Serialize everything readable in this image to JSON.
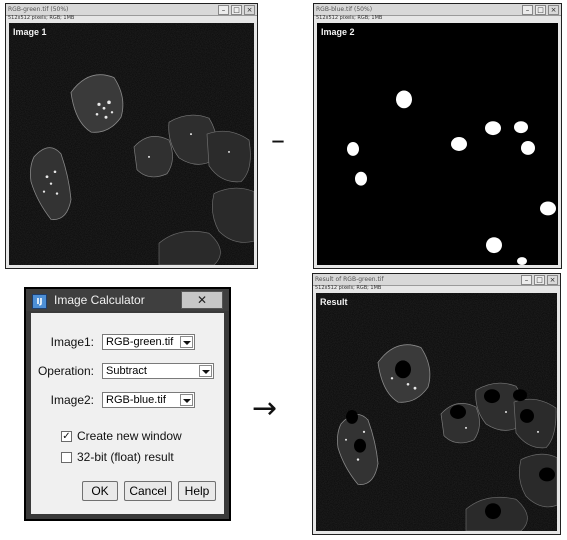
{
  "windows": {
    "image1": {
      "title": "RGB-green.tif (50%)",
      "info": "512x512 pixels; RGB; 1MB",
      "label": "Image 1"
    },
    "image2": {
      "title": "RGB-blue.tif (50%)",
      "info": "512x512 pixels; RGB; 1MB",
      "label": "Image 2"
    },
    "result": {
      "title": "Result of RGB-green.tif",
      "info": "512x512 pixels; RGB; 1MB",
      "label": "Result"
    }
  },
  "operators": {
    "minus": "–",
    "arrow": "→"
  },
  "window_controls": {
    "minimize": "–",
    "maximize": "□",
    "close": "×"
  },
  "dialog": {
    "title": "Image Calculator",
    "icon_text": "IJ",
    "close": "✕",
    "image1_label": "Image1:",
    "image1_value": "RGB-green.tif",
    "operation_label": "Operation:",
    "operation_value": "Subtract",
    "image2_label": "Image2:",
    "image2_value": "RGB-blue.tif",
    "create_new_window_label": "Create new window",
    "create_new_window_checked": true,
    "float_result_label": "32-bit (float) result",
    "float_result_checked": false,
    "ok": "OK",
    "cancel": "Cancel",
    "help": "Help"
  },
  "icons": {
    "dialog_app": "imagej-icon",
    "dialog_close": "close-icon",
    "combo_arrow": "chevron-down-icon",
    "checkbox_mark": "checkmark-icon"
  },
  "colors": {
    "dialog_frame": "#3a3a3a",
    "dialog_body": "#f0f0f0",
    "nuclei": "#ffffff",
    "canvas": "#050505"
  }
}
